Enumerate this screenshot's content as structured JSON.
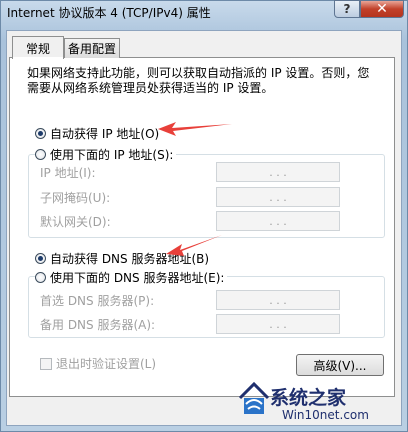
{
  "window": {
    "title": "Internet 协议版本 4 (TCP/IPv4) 属性",
    "help_label": "?",
    "close_label": "✕"
  },
  "tabs": [
    {
      "label": "常规",
      "active": true
    },
    {
      "label": "备用配置",
      "active": false
    }
  ],
  "description": "如果网络支持此功能，则可以获取自动指派的 IP 设置。否则，您需要从网络系统管理员处获得适当的 IP 设置。",
  "ip_section": {
    "auto_label": "自动获得 IP 地址(O)",
    "manual_label": "使用下面的 IP 地址(S):",
    "selected": "auto",
    "fields": [
      {
        "label": "IP 地址(I):",
        "value": ". . ."
      },
      {
        "label": "子网掩码(U):",
        "value": ". . ."
      },
      {
        "label": "默认网关(D):",
        "value": ". . ."
      }
    ]
  },
  "dns_section": {
    "auto_label": "自动获得 DNS 服务器地址(B)",
    "manual_label": "使用下面的 DNS 服务器地址(E):",
    "selected": "auto",
    "fields": [
      {
        "label": "首选 DNS 服务器(P):",
        "value": ". . ."
      },
      {
        "label": "备用 DNS 服务器(A):",
        "value": ". . ."
      }
    ]
  },
  "validate_checkbox": {
    "label": "退出时验证设置(L)",
    "checked": false
  },
  "advanced_button": "高级(V)...",
  "watermark": {
    "name": "系统之家",
    "url": "Win10net.com"
  },
  "colors": {
    "arrow": "#e8403a",
    "accent": "#1d3b6a"
  }
}
